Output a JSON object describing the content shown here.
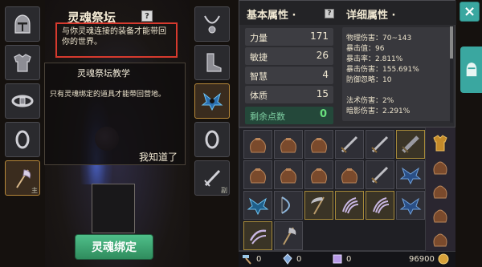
{
  "altar": {
    "title": "灵魂祭坛",
    "help": "?",
    "description": "与你灵魂连接的装备才能带回你的世界。",
    "tutorial_title": "灵魂祭坛教学",
    "tutorial_text": "只有灵魂绑定的道具才能带回营地。",
    "tutorial_ok": "我知道了",
    "bind_button": "灵魂绑定"
  },
  "left_slots": [
    {
      "icon": "helmet-icon"
    },
    {
      "icon": "armor-icon"
    },
    {
      "icon": "belt-icon"
    },
    {
      "icon": "ring-icon"
    },
    {
      "icon": "axe-icon",
      "tag": "主"
    }
  ],
  "right_slots": [
    {
      "icon": "necklace-icon"
    },
    {
      "icon": "boots-icon"
    },
    {
      "icon": "bat-wings-icon"
    },
    {
      "icon": "ring-icon"
    },
    {
      "icon": "sword-icon",
      "tag": "副"
    }
  ],
  "stats": {
    "basic_header": "基本属性 ·",
    "detail_header": "详细属性 ·",
    "help": "?",
    "basic": [
      {
        "label": "力量",
        "value": "171"
      },
      {
        "label": "敏捷",
        "value": "26"
      },
      {
        "label": "智慧",
        "value": "4"
      },
      {
        "label": "体质",
        "value": "15"
      }
    ],
    "free_points_label": "剩余点数",
    "free_points_value": "0",
    "details": [
      "物理伤害：70~143",
      "暴击值：96",
      "暴击率：2.811%",
      "暴击伤害：155.691%",
      "防御忽略：10",
      "",
      "法术伤害：2%",
      "暗影伤害：2.291%"
    ]
  },
  "bottom": {
    "item1_value": "0",
    "item2_value": "0",
    "item3_value": "0",
    "gold_value": "96900"
  },
  "close_label": "×",
  "colors": {
    "accent": "#3aa7a0",
    "bind_button": "#3fa876",
    "highlight_border": "#d63a2e"
  }
}
